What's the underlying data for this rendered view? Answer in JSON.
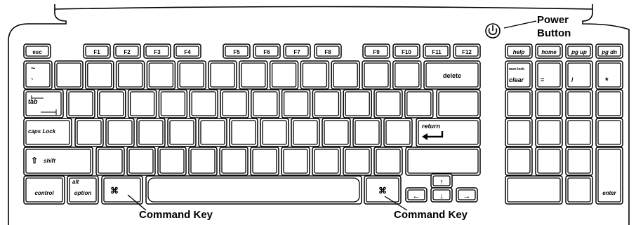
{
  "keyboard": {
    "function_row": [
      "esc",
      "F1",
      "F2",
      "F3",
      "F4",
      "F5",
      "F6",
      "F7",
      "F8",
      "F9",
      "F10",
      "F11",
      "F12"
    ],
    "nav_row": [
      "help",
      "home",
      "pg up",
      "pg dn"
    ],
    "number_row": {
      "tilde_top": "~",
      "tilde_bottom": "`",
      "delete": "delete",
      "num_lock": "num lock",
      "clear": "clear",
      "equals": "=",
      "slash": "/",
      "star": "*"
    },
    "tab_label": "tab",
    "caps_label": "caps Lock",
    "return_label": "return",
    "shift_label": "shift",
    "shift_glyph": "⇧",
    "control_label": "control",
    "alt_label": "alt",
    "option_label": "option",
    "apple_glyph": "",
    "command_glyph": "⌘",
    "arrows": {
      "up": "↑",
      "down": "↓",
      "left": "←",
      "right": "→"
    },
    "enter_label": "enter"
  },
  "callouts": {
    "power_line1": "Power",
    "power_line2": "Button",
    "command_key": "Command Key"
  }
}
